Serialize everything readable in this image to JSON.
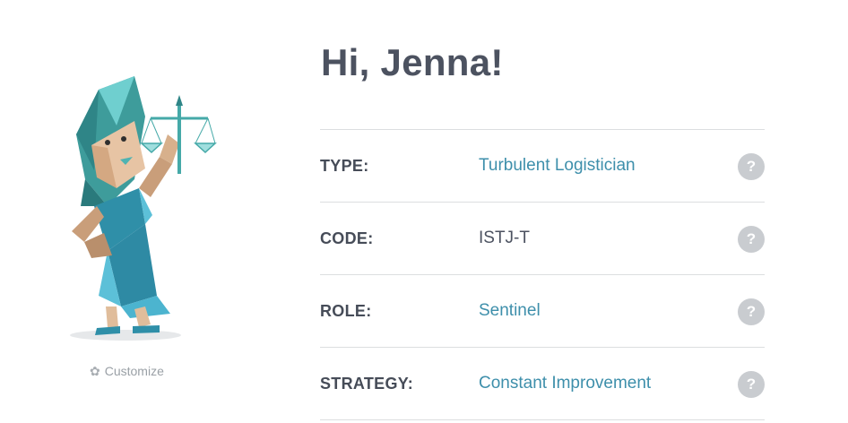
{
  "profile": {
    "greeting": "Hi, Jenna!",
    "customize_label": "Customize"
  },
  "rows": [
    {
      "label": "TYPE:",
      "value": "Turbulent Logistician",
      "help": "?"
    },
    {
      "label": "CODE:",
      "value": "ISTJ-T",
      "help": "?"
    },
    {
      "label": "ROLE:",
      "value": "Sentinel",
      "help": "?"
    },
    {
      "label": "STRATEGY:",
      "value": "Constant Improvement",
      "help": "?"
    }
  ],
  "icons": {
    "customize": "gear-icon",
    "help": "question-icon"
  },
  "colors": {
    "accent": "#3e8fab",
    "heading": "#4c5260",
    "help_badge": "#c9ccd0",
    "divider": "#dcdee0"
  }
}
